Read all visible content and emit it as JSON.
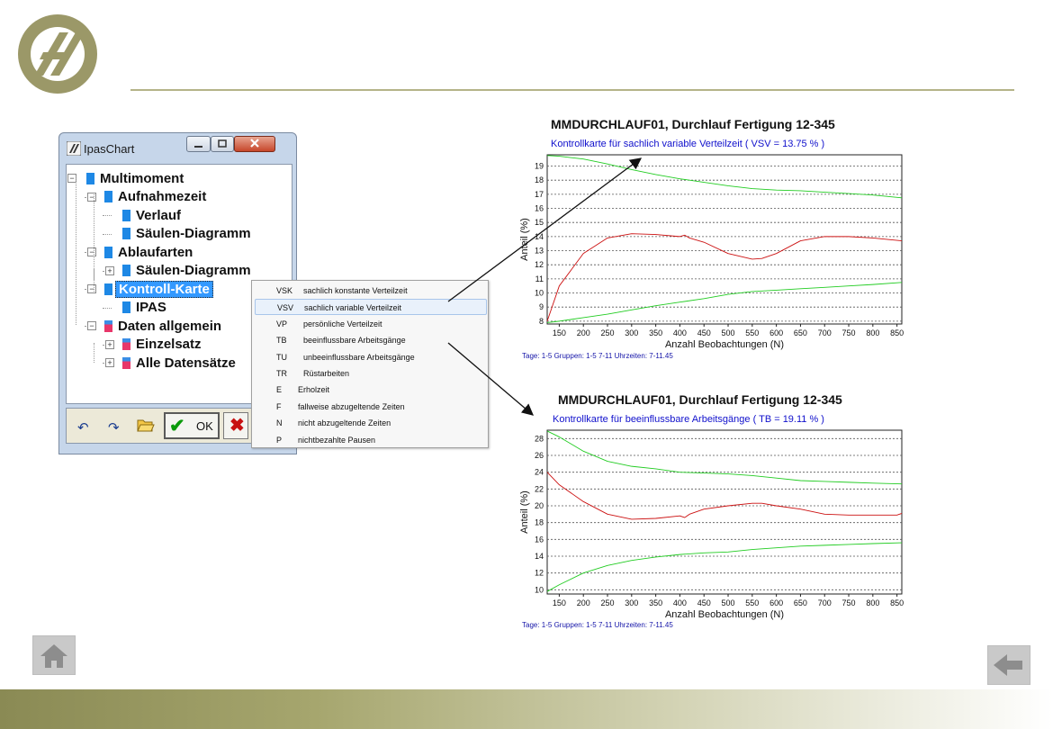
{
  "window": {
    "title": "IpasChart",
    "tree": [
      {
        "label": "Multimoment",
        "level": 0,
        "color": "#1e88e5",
        "toggle": "−"
      },
      {
        "label": "Aufnahmezeit",
        "level": 1,
        "color": "#1e88e5",
        "toggle": "−"
      },
      {
        "label": "Verlauf",
        "level": 2,
        "color": "#1e88e5",
        "toggle": ""
      },
      {
        "label": "Säulen-Diagramm",
        "level": 2,
        "color": "#1e88e5",
        "toggle": ""
      },
      {
        "label": "Ablaufarten",
        "level": 1,
        "color": "#1e88e5",
        "toggle": "−"
      },
      {
        "label": "Säulen-Diagramm",
        "level": 2,
        "color": "#1e88e5",
        "toggle": "+"
      },
      {
        "label": "Kontroll-Karte",
        "level": 1,
        "color": "#1e88e5",
        "toggle": "−",
        "selected": true
      },
      {
        "label": "IPAS",
        "level": 2,
        "color": "#1e88e5",
        "toggle": ""
      },
      {
        "label": "Daten allgemein",
        "level": 1,
        "color": "#e8366a",
        "toggle": "−"
      },
      {
        "label": "Einzelsatz",
        "level": 2,
        "color": "#e8366a",
        "toggle": "+"
      },
      {
        "label": "Alle Datensätze",
        "level": 2,
        "color": "#e8366a",
        "toggle": "+"
      }
    ],
    "toolbar": {
      "ok_label": "OK"
    }
  },
  "menu": {
    "items": [
      {
        "code": "VSK",
        "text": "sachlich konstante Verteilzeit"
      },
      {
        "code": "VSV",
        "text": "sachlich variable Verteilzeit",
        "highlighted": true
      },
      {
        "code": "VP",
        "text": "persönliche Verteilzeit"
      },
      {
        "code": "TB",
        "text": "beeinflussbare Arbeitsgänge"
      },
      {
        "code": "TU",
        "text": "unbeeinflussbare Arbeitsgänge"
      },
      {
        "code": "TR",
        "text": "Rüstarbeiten"
      },
      {
        "code": "E",
        "text": "Erholzeit"
      },
      {
        "code": "F",
        "text": "fallweise abzugeltende Zeiten"
      },
      {
        "code": "N",
        "text": "nicht abzugeltende Zeiten"
      },
      {
        "code": "P",
        "text": "nichtbezahlte Pausen"
      }
    ]
  },
  "colors": {
    "upper_limit": "#22cc22",
    "lower_limit": "#22cc22",
    "value_line": "#cc1111",
    "subtitle": "#1010cc"
  },
  "chart_data": [
    {
      "type": "line",
      "title": "MMDURCHLAUF01, Durchlauf Fertigung 12-345",
      "subtitle": "Kontrollkarte für  sachlich variable Verteilzeit    ( VSV = 13.75 % )",
      "xlabel": "Anzahl Beobachtungen (N)",
      "ylabel": "Anteil (%)",
      "footer": "Tage: 1-5   Gruppen: 1-5 7-11   Uhrzeiten: 7-11.45",
      "xlim": [
        125,
        860
      ],
      "ylim": [
        7.8,
        19.8
      ],
      "xticks": [
        150,
        200,
        250,
        300,
        350,
        400,
        450,
        500,
        550,
        600,
        650,
        700,
        750,
        800,
        850
      ],
      "yticks": [
        8,
        9,
        10,
        11,
        12,
        13,
        14,
        15,
        16,
        17,
        18,
        19
      ],
      "grid": "horizontal",
      "series": [
        {
          "role": "upper",
          "x": [
            125,
            150,
            200,
            250,
            300,
            350,
            400,
            450,
            500,
            550,
            600,
            650,
            700,
            750,
            800,
            860
          ],
          "y": [
            19.75,
            19.7,
            19.5,
            19.15,
            18.75,
            18.4,
            18.1,
            17.85,
            17.6,
            17.4,
            17.3,
            17.25,
            17.15,
            17.05,
            16.95,
            16.75
          ]
        },
        {
          "role": "value",
          "x": [
            125,
            150,
            200,
            250,
            300,
            350,
            400,
            410,
            420,
            450,
            500,
            550,
            570,
            600,
            650,
            700,
            750,
            800,
            860
          ],
          "y": [
            8.0,
            10.5,
            12.8,
            13.9,
            14.2,
            14.15,
            14.0,
            14.1,
            13.9,
            13.6,
            12.8,
            12.4,
            12.45,
            12.8,
            13.7,
            14.0,
            14.0,
            13.9,
            13.7
          ]
        },
        {
          "role": "lower",
          "x": [
            125,
            150,
            200,
            250,
            300,
            350,
            400,
            450,
            500,
            550,
            600,
            650,
            700,
            750,
            800,
            860
          ],
          "y": [
            7.9,
            8.0,
            8.25,
            8.5,
            8.8,
            9.1,
            9.35,
            9.6,
            9.9,
            10.1,
            10.2,
            10.3,
            10.4,
            10.5,
            10.6,
            10.75
          ]
        }
      ]
    },
    {
      "type": "line",
      "title": "MMDURCHLAUF01, Durchlauf Fertigung 12-345",
      "subtitle": "Kontrollkarte für  beeinflussbare Arbeitsgänge    ( TB = 19.11 % )",
      "xlabel": "Anzahl Beobachtungen (N)",
      "ylabel": "Anteil (%)",
      "footer": "Tage: 1-5   Gruppen: 1-5 7-11   Uhrzeiten: 7-11.45",
      "xlim": [
        125,
        860
      ],
      "ylim": [
        9.5,
        29
      ],
      "xticks": [
        150,
        200,
        250,
        300,
        350,
        400,
        450,
        500,
        550,
        600,
        650,
        700,
        750,
        800,
        850
      ],
      "yticks": [
        10,
        12,
        14,
        16,
        18,
        20,
        22,
        24,
        26,
        28
      ],
      "grid": "horizontal",
      "series": [
        {
          "role": "upper",
          "x": [
            125,
            150,
            200,
            250,
            300,
            350,
            400,
            450,
            500,
            550,
            600,
            650,
            700,
            750,
            800,
            860
          ],
          "y": [
            28.9,
            28.2,
            26.5,
            25.3,
            24.7,
            24.4,
            24.0,
            23.9,
            23.8,
            23.6,
            23.3,
            23.0,
            22.9,
            22.8,
            22.7,
            22.6
          ]
        },
        {
          "role": "value",
          "x": [
            125,
            150,
            200,
            250,
            300,
            350,
            400,
            410,
            420,
            450,
            500,
            550,
            570,
            600,
            650,
            700,
            750,
            800,
            850,
            860
          ],
          "y": [
            24.0,
            22.5,
            20.5,
            19.0,
            18.4,
            18.5,
            18.8,
            18.6,
            19.0,
            19.6,
            20.0,
            20.3,
            20.3,
            20.0,
            19.6,
            19.0,
            18.9,
            18.9,
            18.9,
            19.1
          ]
        },
        {
          "role": "lower",
          "x": [
            125,
            150,
            200,
            250,
            300,
            350,
            400,
            450,
            500,
            550,
            600,
            650,
            700,
            750,
            800,
            860
          ],
          "y": [
            9.8,
            10.6,
            12.0,
            12.9,
            13.5,
            13.9,
            14.2,
            14.4,
            14.5,
            14.8,
            15.0,
            15.2,
            15.3,
            15.4,
            15.5,
            15.6
          ]
        }
      ]
    }
  ]
}
